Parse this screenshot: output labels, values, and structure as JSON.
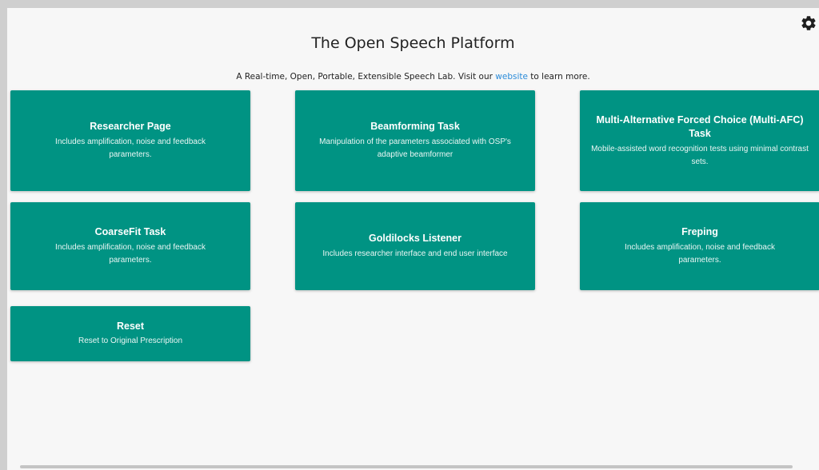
{
  "page": {
    "title": "The Open Speech Platform",
    "subtitle_before": "A Real-time, Open, Portable, Extensible Speech Lab. Visit our ",
    "subtitle_link": "website",
    "subtitle_after": " to learn more."
  },
  "settings": {
    "icon": "gear-icon"
  },
  "colors": {
    "card_bg": "#009383",
    "link": "#2a8bd9",
    "page_bg": "#f7f7f7"
  },
  "cards": [
    {
      "title": "Researcher Page",
      "desc": "Includes amplification, noise and feedback parameters."
    },
    {
      "title": "Beamforming Task",
      "desc": "Manipulation of the parameters associated with OSP's adaptive beamformer"
    },
    {
      "title": "Multi-Alternative Forced Choice (Multi-AFC) Task",
      "desc": "Mobile-assisted word recognition tests using minimal contrast sets."
    },
    {
      "title": "CoarseFit Task",
      "desc": "Includes amplification, noise and feedback parameters."
    },
    {
      "title": "Goldilocks Listener",
      "desc": "Includes researcher interface and end user interface"
    },
    {
      "title": "Freping",
      "desc": "Includes amplification, noise and feedback parameters."
    },
    {
      "title": "Reset",
      "desc": "Reset to Original Prescription"
    }
  ]
}
